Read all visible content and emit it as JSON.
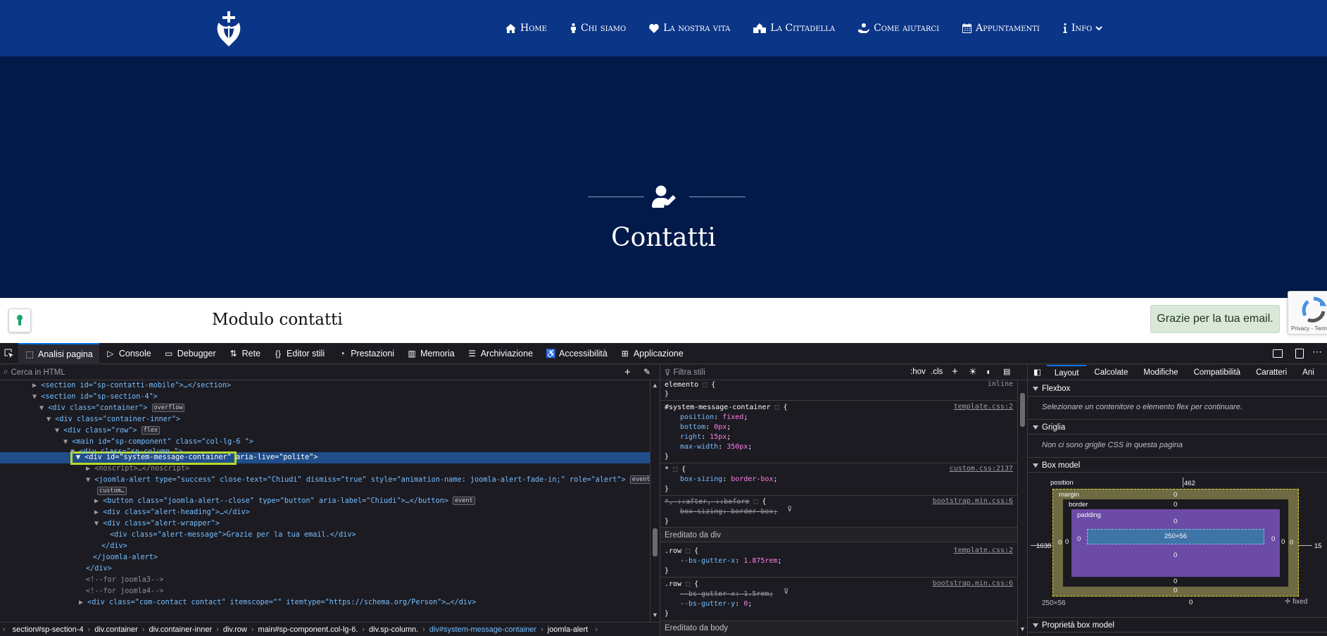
{
  "site": {
    "nav": [
      {
        "label": "Home",
        "icon": "home-icon"
      },
      {
        "label": "Chi siamo",
        "icon": "person-icon"
      },
      {
        "label": "La nostra vita",
        "icon": "heart-icon"
      },
      {
        "label": "La Cittadella",
        "icon": "building-icon"
      },
      {
        "label": "Come aiutarci",
        "icon": "helping-hand-icon"
      },
      {
        "label": "Appuntamenti",
        "icon": "calendar-icon"
      },
      {
        "label": "Info",
        "icon": "info-icon"
      }
    ],
    "hero_title": "Contatti",
    "section_title": "Modulo contatti",
    "alert_text": "Grazie per la tua email.",
    "recaptcha_text": "Privacy - Term",
    "colors": {
      "nav": "#0b3586",
      "hero": "#011a4a",
      "alert_bg": "#d9e8d8"
    }
  },
  "devtools": {
    "tabs": [
      "Analisi pagina",
      "Console",
      "Debugger",
      "Rete",
      "Editor stili",
      "Prestazioni",
      "Memoria",
      "Archiviazione",
      "Accessibilità",
      "Applicazione"
    ],
    "search_placeholder": "Cerca in HTML",
    "filter_placeholder": "Filtra stili",
    "pseudo_hov": ":hov",
    "pseudo_cls": ".cls",
    "breadcrumb": [
      "section#sp-section-4",
      "div.container",
      "div.container-inner",
      "div.row",
      "main#sp-component.col-lg-6.",
      "div.sp-column.",
      "div#system-message-container",
      "joomla-alert"
    ],
    "html_lines": [
      "<section id=\"sp-contatti-mobile\">…</section>",
      "<section id=\"sp-section-4\">",
      "<div class=\"container\">",
      "<div class=\"container-inner\">",
      "<div class=\"row\">",
      "<main id=\"sp-component\" class=\"col-lg-6 \">",
      "<div class=\"sp-column \">",
      "<div id=\"system-message-container\" aria-live=\"polite\">",
      "<noscript>…</noscript>",
      "<joomla-alert type=\"success\" close-text=\"Chiudi\" dismiss=\"true\" style=\"animation-name: joomla-alert-fade-in;\" role=\"alert\">",
      "<button class=\"joomla-alert--close\" type=\"button\" aria-label=\"Chiudi\">…</button>",
      "<div class=\"alert-heading\">…</div>",
      "<div class=\"alert-wrapper\">",
      "<div class=\"alert-message\">Grazie per la tua email.</div>",
      "</div>",
      "</joomla-alert>",
      "</div>",
      "<!--for joomla3-->",
      "<!--for joomla4-->",
      "<div class=\"com-contact contact\" itemscope=\"\" itemtype=\"https://schema.org/Person\">…</div>"
    ],
    "badges": {
      "overflow": "overflow",
      "flex": "flex",
      "event": "event",
      "custom": "custom…"
    },
    "rules": {
      "element_selector": "elemento",
      "element_inline": "inline",
      "r1_selector": "#system-message-container",
      "r1_source": "template.css:2",
      "r1_props": [
        [
          "position",
          "fixed"
        ],
        [
          "bottom",
          "0px"
        ],
        [
          "right",
          "15px"
        ],
        [
          "max-width",
          "350px"
        ]
      ],
      "r2_selector": "*",
      "r2_source": "custom.css:2137",
      "r2_prop": [
        "box-sizing",
        "border-box"
      ],
      "r3_selector": "*, ::after, ::before",
      "r3_source": "bootstrap.min.css:6",
      "r3_prop": [
        "box-sizing",
        "border-box"
      ],
      "inherited": "Ereditato da div",
      "r4_selector": ".row",
      "r4_source": "template.css:2",
      "r4_prop": [
        "--bs-gutter-x",
        "1.875rem"
      ],
      "r5_selector": ".row",
      "r5_source": "bootstrap.min.css:6",
      "r5_props": [
        [
          "--bs-gutter-x",
          "1.5rem"
        ],
        [
          "--bs-gutter-y",
          "0"
        ]
      ],
      "more": "Ereditato da body"
    },
    "layout_tabs": [
      "Layout",
      "Calcolate",
      "Modifiche",
      "Compatibilità",
      "Caratteri",
      "Ani"
    ],
    "flexbox": "Flexbox",
    "flex_note": "Selezionare un contenitore o elemento flex per continuare.",
    "grid": "Griglia",
    "grid_note": "Non ci sono griglie CSS in questa pagina",
    "boxmodel": "Box model",
    "bm": {
      "position": "position",
      "top": "462",
      "left": "1638",
      "right": "15",
      "bottom": "0",
      "margin": "margin",
      "border": "border",
      "padding": "padding",
      "content": "250×56",
      "zero": "0"
    },
    "size": "250×56",
    "fixed": "fixed",
    "props_title": "Proprietà box model"
  }
}
